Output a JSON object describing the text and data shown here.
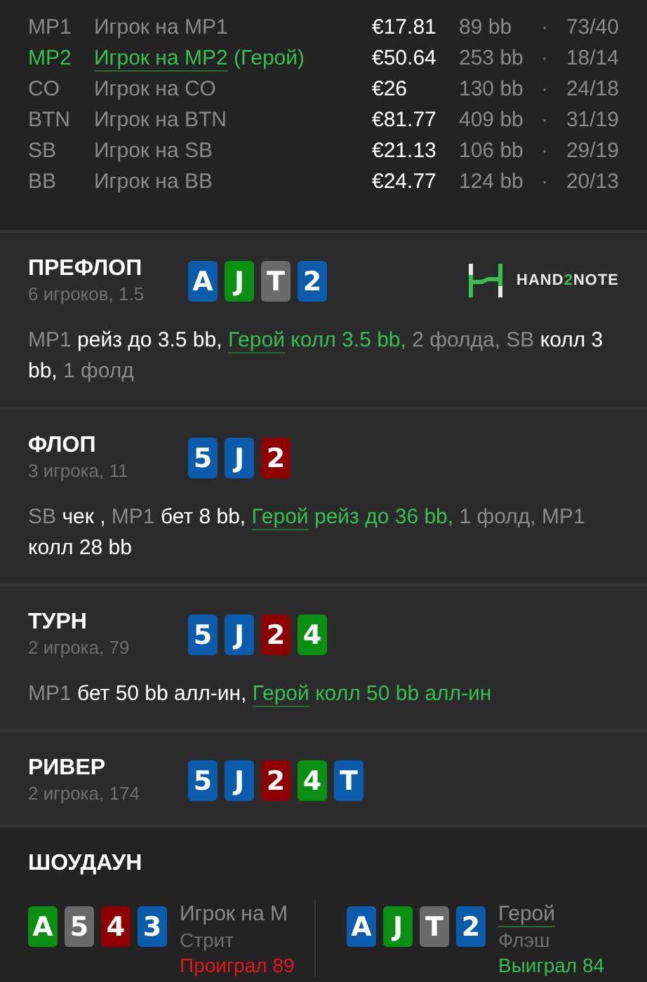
{
  "players": [
    {
      "position": "MP1",
      "name": "Игрок на MP1",
      "stack": "€17.81",
      "bb": "89 bb",
      "separator": "·",
      "stats": "73/40",
      "hero": false
    },
    {
      "position": "MP2",
      "name": "Игрок на MP2",
      "hero_label": "(Герой)",
      "stack": "€50.64",
      "bb": "253 bb",
      "separator": "·",
      "stats": "18/14",
      "hero": true
    },
    {
      "position": "CO",
      "name": "Игрок на CO",
      "stack": "€26",
      "bb": "130 bb",
      "separator": "·",
      "stats": "24/18",
      "hero": false
    },
    {
      "position": "BTN",
      "name": "Игрок на BTN",
      "stack": "€81.77",
      "bb": "409 bb",
      "separator": "·",
      "stats": "31/19",
      "hero": false
    },
    {
      "position": "SB",
      "name": "Игрок на SB",
      "stack": "€21.13",
      "bb": "106 bb",
      "separator": "·",
      "stats": "29/19",
      "hero": false
    },
    {
      "position": "BB",
      "name": "Игрок на BB",
      "stack": "€24.77",
      "bb": "124 bb",
      "separator": "·",
      "stats": "20/13",
      "hero": false
    }
  ],
  "streets": [
    {
      "title": "ПРЕФЛОП",
      "info": "6 игроков, 1.5",
      "cards": [
        {
          "rank": "A",
          "color": "#0b5cad"
        },
        {
          "rank": "J",
          "color": "#0a8f12"
        },
        {
          "rank": "T",
          "color": "#6a6a6a"
        },
        {
          "rank": "2",
          "color": "#0b5cad"
        }
      ],
      "logo": {
        "parts": [
          {
            "text": "HAND",
            "accent": false
          },
          {
            "text": "2",
            "accent": true
          },
          {
            "text": "NOTE",
            "accent": false
          }
        ]
      },
      "actions": [
        {
          "kind": "player",
          "text": "MP1"
        },
        {
          "kind": "action",
          "text": "рейз до 3.5 bb,"
        },
        {
          "kind": "hero",
          "text": "Герой"
        },
        {
          "kind": "hero_action",
          "text": "колл 3.5 bb,"
        },
        {
          "kind": "muted",
          "text": "2 фолда,"
        },
        {
          "kind": "player",
          "text": "SB"
        },
        {
          "kind": "action",
          "text": "колл 3 bb,"
        },
        {
          "kind": "muted",
          "text": "1 фолд"
        }
      ]
    },
    {
      "title": "ФЛОП",
      "info": "3 игрока, 11",
      "cards": [
        {
          "rank": "5",
          "color": "#0b5cad"
        },
        {
          "rank": "J",
          "color": "#0b5cad"
        },
        {
          "rank": "2",
          "color": "#8e0000"
        }
      ],
      "actions": [
        {
          "kind": "player",
          "text": "SB"
        },
        {
          "kind": "action",
          "text": "чек ,"
        },
        {
          "kind": "player",
          "text": "MP1"
        },
        {
          "kind": "action",
          "text": "бет 8 bb,"
        },
        {
          "kind": "hero",
          "text": "Герой"
        },
        {
          "kind": "hero_action",
          "text": "рейз до 36 bb,"
        },
        {
          "kind": "muted",
          "text": "1 фолд,"
        },
        {
          "kind": "player",
          "text": "MP1"
        },
        {
          "kind": "action",
          "text": "колл 28 bb"
        }
      ]
    },
    {
      "title": "ТУРН",
      "info": "2 игрока, 79",
      "cards": [
        {
          "rank": "5",
          "color": "#0b5cad"
        },
        {
          "rank": "J",
          "color": "#0b5cad"
        },
        {
          "rank": "2",
          "color": "#8e0000"
        },
        {
          "rank": "4",
          "color": "#0a8f12"
        }
      ],
      "actions": [
        {
          "kind": "player",
          "text": "MP1"
        },
        {
          "kind": "action",
          "text": "бет 50 bb алл-ин,"
        },
        {
          "kind": "hero",
          "text": "Герой"
        },
        {
          "kind": "hero_action",
          "text": "колл 50 bb алл-ин"
        }
      ]
    },
    {
      "title": "РИВЕР",
      "info": "2 игрока, 174",
      "cards": [
        {
          "rank": "5",
          "color": "#0b5cad"
        },
        {
          "rank": "J",
          "color": "#0b5cad"
        },
        {
          "rank": "2",
          "color": "#8e0000"
        },
        {
          "rank": "4",
          "color": "#0a8f12"
        },
        {
          "rank": "T",
          "color": "#0b5cad"
        }
      ]
    }
  ],
  "showdown": {
    "title": "ШОУДАУН",
    "hands": [
      {
        "cards": [
          {
            "rank": "A",
            "color": "#0a8f12"
          },
          {
            "rank": "5",
            "color": "#6a6a6a"
          },
          {
            "rank": "4",
            "color": "#8e0000"
          },
          {
            "rank": "3",
            "color": "#0b5cad"
          }
        ],
        "name": "Игрок на M",
        "hero": false,
        "hand": "Стрит",
        "result": "Проиграл 89",
        "won": false
      },
      {
        "cards": [
          {
            "rank": "A",
            "color": "#0b5cad"
          },
          {
            "rank": "J",
            "color": "#0a8f12"
          },
          {
            "rank": "T",
            "color": "#6a6a6a"
          },
          {
            "rank": "2",
            "color": "#0b5cad"
          }
        ],
        "name": "Герой",
        "hero": true,
        "hand": "Флэш",
        "result": "Выиграл 84",
        "won": true
      }
    ]
  }
}
